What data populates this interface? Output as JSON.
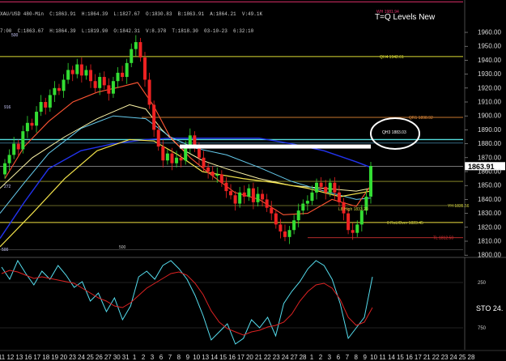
{
  "header": {
    "line1": "XAU/USD 480-Min  C:1863.91  H:1864.39  L:1827.67  O:1830.83  B:1863.91  A:1864.21  V:49.1K",
    "line2": "7:00  C:1863.67  H:1864.39  L:1819.90  O:1842.31  V:8.378  T:1818.30  03-10-23  6:32:10"
  },
  "title": "T=Q Levels New",
  "price_badge": "1863.91",
  "level_labels": [
    {
      "text": "WH 1981.94",
      "color": "#e0306a"
    },
    {
      "text": "QH4 1942.61",
      "color": "#dddd33"
    },
    {
      "text": "QR1 1898.92",
      "color": "#e08b3a"
    },
    {
      "text": "QH3 1883.03",
      "color": "#ffffff"
    },
    {
      "text": "YH 1835.56",
      "color": "#d6d640"
    },
    {
      "text": "L8 High 1833.20",
      "color": "#d6d640"
    },
    {
      "text": "0 RoLlOver 1823.45",
      "color": "#d6d640"
    },
    {
      "text": "TL 1812.50",
      "color": "#e03030"
    }
  ],
  "left_labels": [
    "500",
    "916",
    "272",
    "500"
  ],
  "mid_label": "500",
  "y_ticks": [
    "1960.00",
    "1950.00",
    "1940.00",
    "1930.00",
    "1920.00",
    "1910.00",
    "1900.00",
    "1890.00",
    "1880.00",
    "1870.00",
    "1860.00",
    "1850.00",
    "1840.00",
    "1830.00",
    "1820.00",
    "1810.00",
    "1800.00"
  ],
  "osc_ticks": [
    "250",
    "750"
  ],
  "osc_label": "STO  24.",
  "x_labels": [
    "11",
    "12",
    "13",
    "16",
    "17",
    "18",
    "19",
    "20",
    "23",
    "24",
    "25",
    "26",
    "27",
    "30",
    "31",
    "1",
    "2",
    "3",
    "6",
    "7",
    "8",
    "9",
    "10",
    "13",
    "14",
    "15",
    "16",
    "17",
    "20",
    "21",
    "22",
    "23",
    "24",
    "27",
    "28",
    "1",
    "2",
    "3",
    "6",
    "7",
    "8",
    "9",
    "10",
    "11",
    "14",
    "15",
    "16",
    "17",
    "21",
    "22",
    "23",
    "24",
    "25",
    "28"
  ],
  "colors": {
    "background": "#000000",
    "bull": "#33dd33",
    "bear": "#ee2222",
    "ma_red": "#ff5533",
    "ma_yellow": "#f2e24a",
    "ma_lightyellow": "#fff7a8",
    "ma_cyan": "#66ccee",
    "ma_blue": "#2233ee",
    "sto_cyan": "#55ddee",
    "sto_red": "#dd2222"
  }
}
